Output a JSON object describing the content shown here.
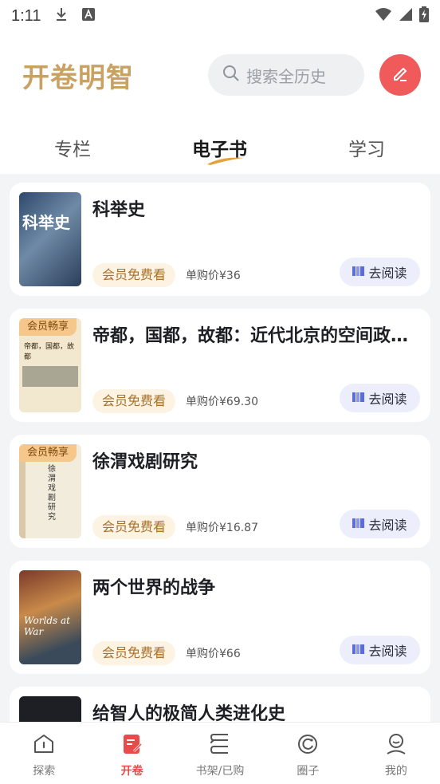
{
  "status": {
    "time": "1:11"
  },
  "header": {
    "logo": "开卷明智",
    "search_placeholder": "搜索全历史"
  },
  "tabs": [
    {
      "label": "专栏",
      "active": false
    },
    {
      "label": "电子书",
      "active": true
    },
    {
      "label": "学习",
      "active": false
    }
  ],
  "books": [
    {
      "title": "科举史",
      "vip_tag": "会员免费看",
      "price": "单购价¥36",
      "read_label": "去阅读",
      "cover_badge": "",
      "cover_text": "科举史"
    },
    {
      "title": "帝都，国都，故都：近代北京的空间政治与文化表象",
      "vip_tag": "会员免费看",
      "price": "单购价¥69.30",
      "read_label": "去阅读",
      "cover_badge": "会员畅享",
      "cover_text": "帝都，国都，故都"
    },
    {
      "title": "徐渭戏剧研究",
      "vip_tag": "会员免费看",
      "price": "单购价¥16.87",
      "read_label": "去阅读",
      "cover_badge": "会员畅享",
      "cover_text": "徐渭戏剧研究"
    },
    {
      "title": "两个世界的战争",
      "vip_tag": "会员免费看",
      "price": "单购价¥66",
      "read_label": "去阅读",
      "cover_badge": "",
      "cover_text": "Worlds at War"
    },
    {
      "title": "给智人的极简人类进化史",
      "vip_tag": "",
      "price": "",
      "read_label": "",
      "cover_badge": "",
      "cover_text": ""
    }
  ],
  "nav": [
    {
      "label": "探索",
      "icon": "explore-icon",
      "active": false
    },
    {
      "label": "开卷",
      "icon": "open-book-icon",
      "active": true
    },
    {
      "label": "书架/已购",
      "icon": "bookshelf-icon",
      "active": false
    },
    {
      "label": "圈子",
      "icon": "circle-icon",
      "active": false
    },
    {
      "label": "我的",
      "icon": "profile-icon",
      "active": false
    }
  ],
  "colors": {
    "accent": "#ea4a4a",
    "logo": "#c9a263",
    "vip_text": "#a8712b"
  }
}
